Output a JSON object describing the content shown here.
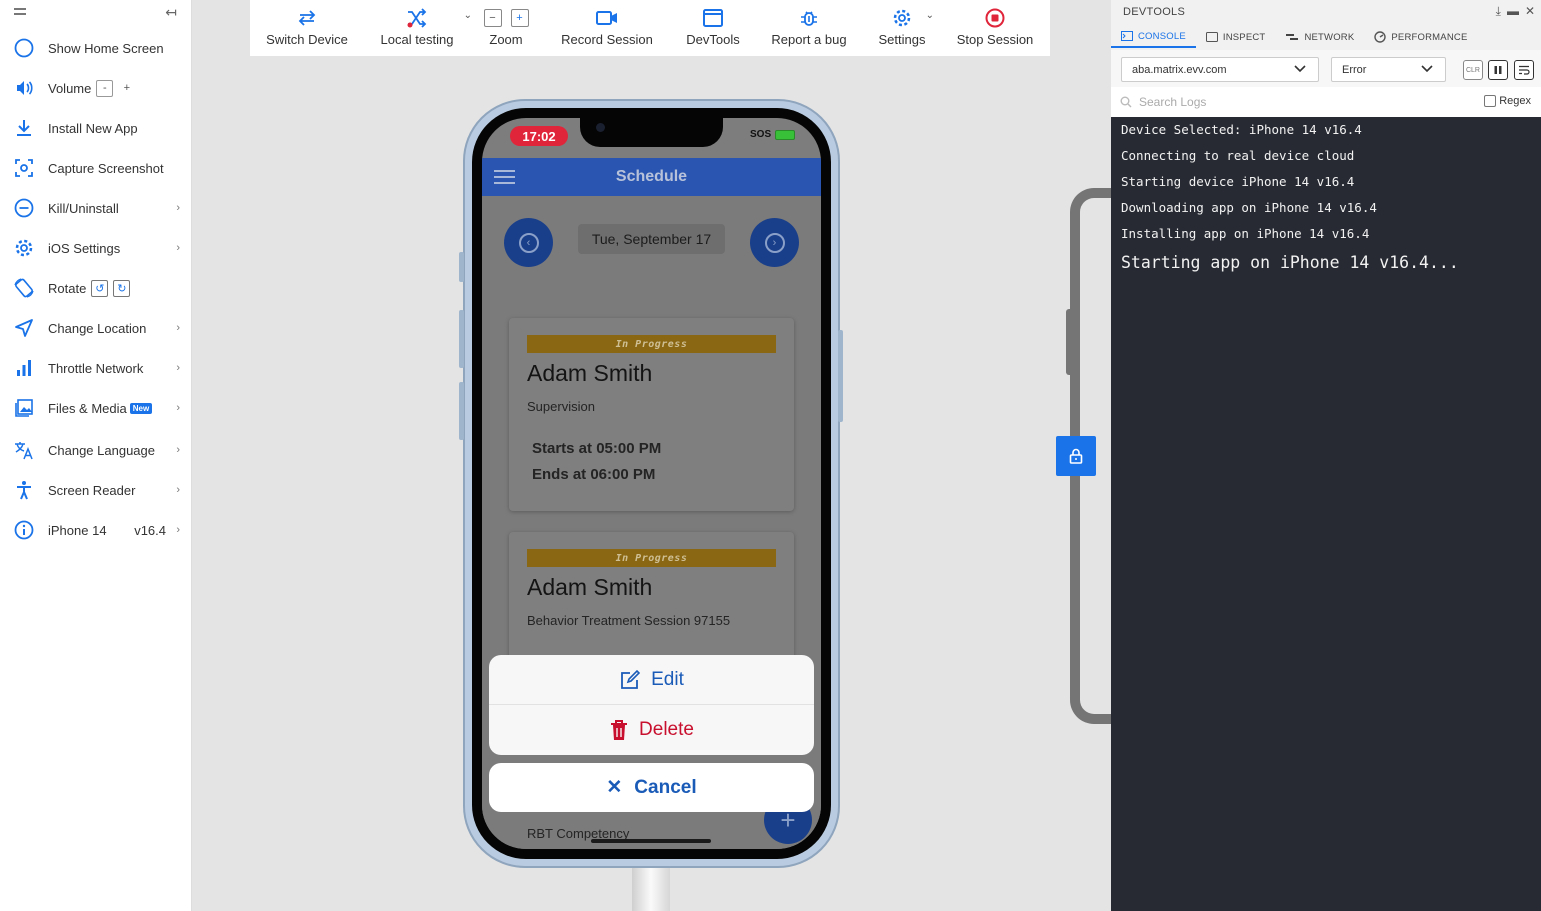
{
  "sidebar": {
    "items": [
      {
        "label": "Show Home Screen"
      },
      {
        "label": "Volume",
        "minus": "-",
        "plus": "+"
      },
      {
        "label": "Install New App"
      },
      {
        "label": "Capture Screenshot"
      },
      {
        "label": "Kill/Uninstall"
      },
      {
        "label": "iOS Settings"
      },
      {
        "label": "Rotate"
      },
      {
        "label": "Change Location"
      },
      {
        "label": "Throttle Network"
      },
      {
        "label": "Files & Media",
        "badge": "New"
      },
      {
        "label": "Change Language"
      },
      {
        "label": "Screen Reader"
      },
      {
        "label": "iPhone 14",
        "version": "v16.4"
      }
    ]
  },
  "toolbar": {
    "switch_device": "Switch Device",
    "local_testing": "Local testing",
    "zoom": "Zoom",
    "record_session": "Record Session",
    "devtools": "DevTools",
    "report_bug": "Report a bug",
    "settings": "Settings",
    "stop_session": "Stop Session"
  },
  "device": {
    "status_time": "17:02",
    "status_sos": "SOS",
    "app_title": "Schedule",
    "date": "Tue, September 17",
    "cards": [
      {
        "status": "In Progress",
        "name": "Adam Smith",
        "type": "Supervision",
        "starts": "Starts at 05:00 PM",
        "ends": "Ends at 06:00 PM"
      },
      {
        "status": "In Progress",
        "name": "Adam Smith",
        "type": "Behavior Treatment Session 97155"
      }
    ],
    "third_card_label": "RBT Competency",
    "fab": "+",
    "action_sheet": {
      "edit": "Edit",
      "delete": "Delete",
      "cancel": "Cancel"
    }
  },
  "devtools": {
    "title": "DEVTOOLS",
    "tabs": [
      "CONSOLE",
      "INSPECT",
      "NETWORK",
      "PERFORMANCE"
    ],
    "url_select": "aba.matrix.evv.com",
    "level_select": "Error",
    "clr": "CLR",
    "search_placeholder": "Search Logs",
    "regex_label": "Regex",
    "logs": [
      "Device Selected: iPhone 14 v16.4",
      "Connecting to real device cloud",
      "Starting device iPhone 14 v16.4",
      "Downloading app on iPhone 14 v16.4",
      "Installing app on iPhone 14 v16.4",
      "Starting app on iPhone 14 v16.4..."
    ]
  },
  "colors": {
    "accent": "#1a73e8",
    "app_header": "#2a55b0",
    "status_in_progress": "#8a6813",
    "delete_red": "#c8102e",
    "console_bg": "#272a33"
  }
}
